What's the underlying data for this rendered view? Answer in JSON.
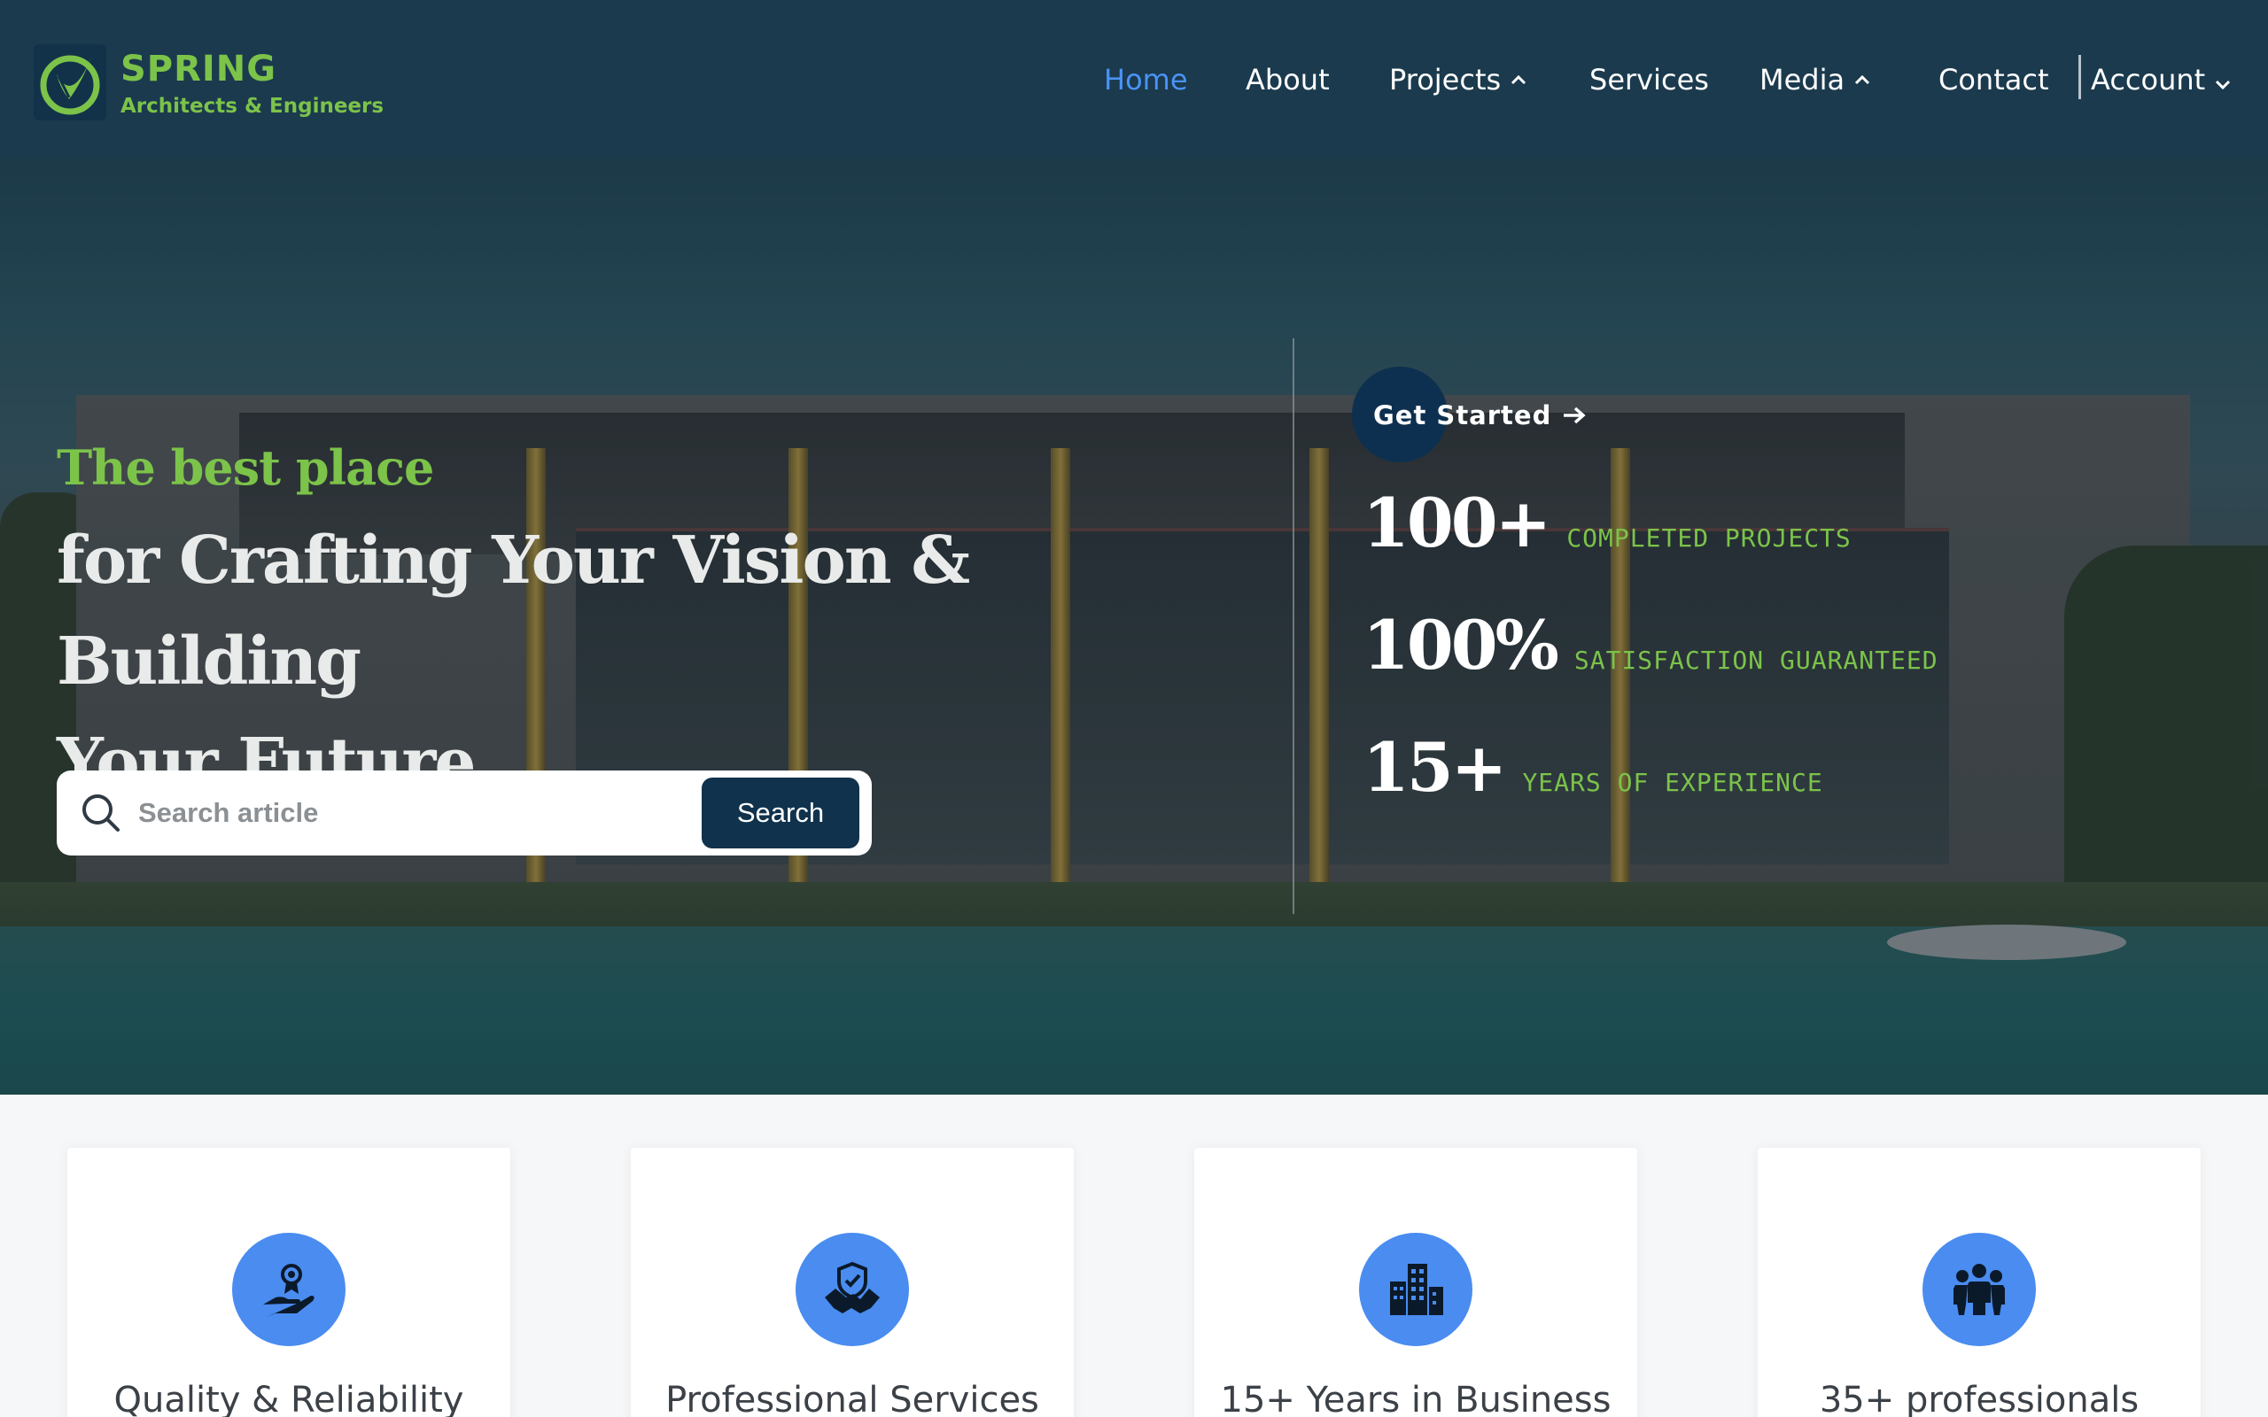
{
  "brand": {
    "name": "SPRING",
    "tagline": "Architects & Engineers",
    "logo_icon": "leaf-check-logo",
    "accent_color": "#7cc34a"
  },
  "nav": {
    "items": [
      {
        "label": "Home",
        "active": true
      },
      {
        "label": "About"
      },
      {
        "label": "Projects",
        "icon": "chevron-up-icon"
      },
      {
        "label": "Services"
      },
      {
        "label": "Media",
        "icon": "chevron-up-icon"
      },
      {
        "label": "Contact"
      }
    ],
    "account": {
      "label": "Account",
      "icon": "chevron-down-icon"
    },
    "active_color": "#4a93f5"
  },
  "hero": {
    "kicker": "The best place",
    "title_line1": "for Crafting Your Vision & Building",
    "title_line2": "Your Future",
    "search": {
      "placeholder": "Search article",
      "value": "",
      "button_label": "Search"
    },
    "cta": {
      "label": "Get Started",
      "icon": "arrow-right-icon"
    },
    "stats": [
      {
        "value": "100+",
        "label": "COMPLETED PROJECTS"
      },
      {
        "value": "100%",
        "label": "SATISFACTION GUARANTEED"
      },
      {
        "value": "15+",
        "label": "YEARS OF EXPERIENCE"
      }
    ]
  },
  "features": [
    {
      "title": "Quality & Reliability",
      "icon": "hand-award-icon"
    },
    {
      "title": "Professional Services",
      "icon": "handshake-shield-icon"
    },
    {
      "title": "15+ Years in Business",
      "icon": "buildings-icon"
    },
    {
      "title": "35+ professionals",
      "icon": "team-icon"
    }
  ],
  "colors": {
    "header_bg": "#1b3a4e",
    "button_dark": "#10324c",
    "icon_circle": "#4a8cf0"
  }
}
